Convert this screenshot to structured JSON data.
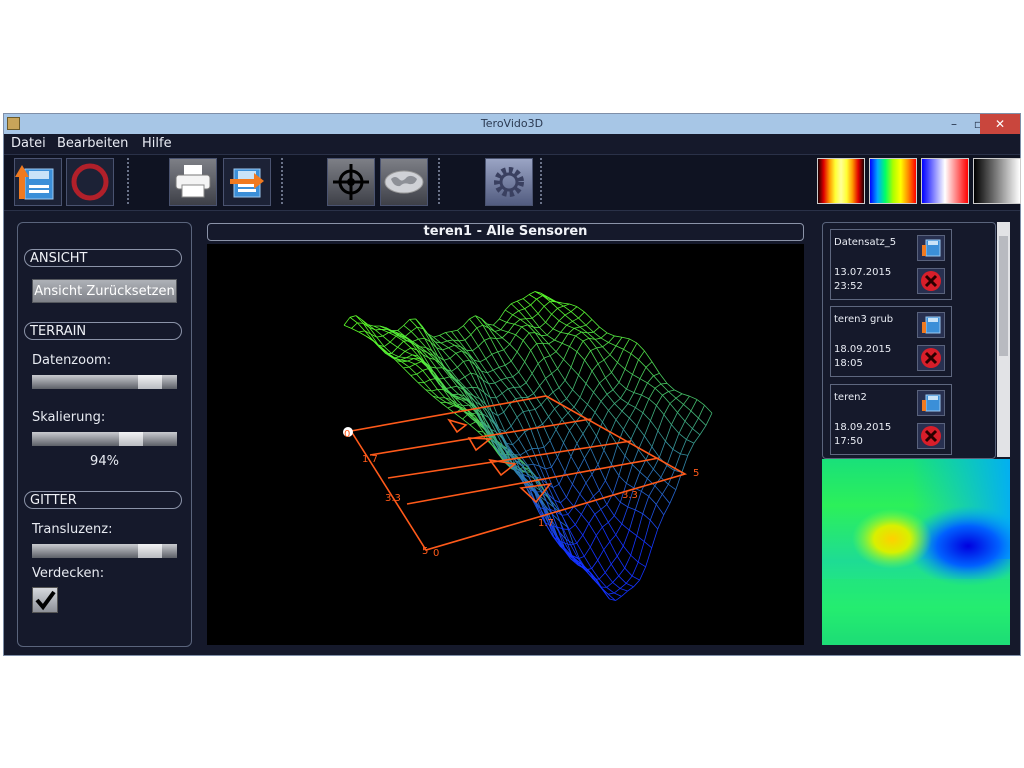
{
  "window": {
    "title": "TeroVido3D"
  },
  "menu": {
    "file": "Datei",
    "edit": "Bearbeiten",
    "help": "Hilfe"
  },
  "toolbar": {
    "buttons": [
      "open-icon",
      "record-icon",
      "print-icon",
      "export-icon",
      "target-icon",
      "map-icon",
      "settings-icon"
    ],
    "palettes": [
      "palette-heat",
      "palette-rainbow",
      "palette-bluewhitered",
      "palette-grayscale"
    ]
  },
  "left_panel": {
    "view_heading": "ANSICHT",
    "reset_view_label": "Ansicht Zurücksetzen",
    "terrain_heading": "TERRAIN",
    "data_zoom_label": "Datenzoom:",
    "data_zoom_level": 0.88,
    "scaling_label": "Skalierung:",
    "scaling_level": 0.72,
    "scaling_value": "94%",
    "grid_heading": "GITTER",
    "translucency_label": "Transluzenz:",
    "translucency_level": 0.88,
    "hide_label": "Verdecken:",
    "hide_checked": true
  },
  "viewport": {
    "title": "teren1 - Alle Sensoren",
    "axis_labels": [
      "0",
      "1.7",
      "3.3",
      "5",
      "3.3",
      "1.7",
      "5",
      "0"
    ]
  },
  "datasets": [
    {
      "name": "Datensatz_5",
      "date": "13.07.2015",
      "time": "23:52"
    },
    {
      "name": "teren3 grub",
      "date": "18.09.2015",
      "time": "18:05"
    },
    {
      "name": "teren2",
      "date": "18.09.2015",
      "time": "17:50"
    }
  ],
  "colors": {
    "window_bg": "#15192b",
    "titlebar": "#a7c6e6",
    "grid_orange": "#ff5a1a",
    "close_red": "#c9463d"
  }
}
